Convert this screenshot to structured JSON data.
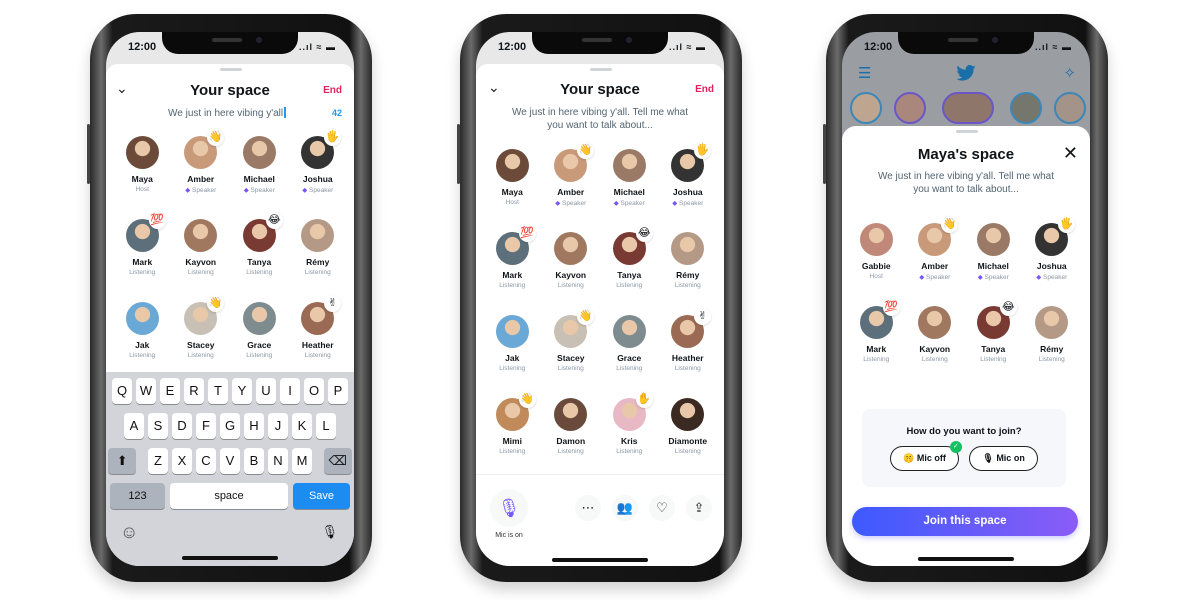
{
  "status": {
    "time": "12:00",
    "signal": "..ıl ≈ ▬"
  },
  "colors": {
    "accent_pink": "#e0245e",
    "twitter_blue": "#1d9bf0",
    "speaker_purple": "#7856ff",
    "join_gradient": [
      "#3d5afe",
      "#8b5cf6"
    ]
  },
  "phone1": {
    "title": "Your space",
    "end_label": "End",
    "title_input": "We just in here vibing y'all",
    "char_count": "42",
    "participants": [
      {
        "name": "Maya",
        "role": "Host",
        "emoji": "",
        "color": "#6b4a3a"
      },
      {
        "name": "Amber",
        "role": "Speaker",
        "emoji": "👋",
        "color": "#c89a7a"
      },
      {
        "name": "Michael",
        "role": "Speaker",
        "emoji": "",
        "color": "#9a7a66"
      },
      {
        "name": "Joshua",
        "role": "Speaker",
        "emoji": "🖐",
        "color": "#333"
      },
      {
        "name": "Mark",
        "role": "Listening",
        "emoji": "💯",
        "color": "#5c6f7a"
      },
      {
        "name": "Kayvon",
        "role": "Listening",
        "emoji": "",
        "color": "#a07860"
      },
      {
        "name": "Tanya",
        "role": "Listening",
        "emoji": "😂",
        "color": "#7a3a34"
      },
      {
        "name": "Rémy",
        "role": "Listening",
        "emoji": "",
        "color": "#b49a86"
      },
      {
        "name": "Jak",
        "role": "Listening",
        "emoji": "",
        "color": "#6aa8d6"
      },
      {
        "name": "Stacey",
        "role": "Listening",
        "emoji": "👋",
        "color": "#c8c0b4"
      },
      {
        "name": "Grace",
        "role": "Listening",
        "emoji": "",
        "color": "#7e8c90"
      },
      {
        "name": "Heather",
        "role": "Listening",
        "emoji": "✌",
        "color": "#9a6a54"
      }
    ],
    "keyboard": {
      "row1": [
        "Q",
        "W",
        "E",
        "R",
        "T",
        "Y",
        "U",
        "I",
        "O",
        "P"
      ],
      "row2": [
        "A",
        "S",
        "D",
        "F",
        "G",
        "H",
        "J",
        "K",
        "L"
      ],
      "row3": [
        "Z",
        "X",
        "C",
        "V",
        "B",
        "N",
        "M"
      ],
      "shift": "⬆",
      "backspace": "⌫",
      "numbers": "123",
      "space": "space",
      "save": "Save",
      "emoji": "☺",
      "mic": "🎙"
    }
  },
  "phone2": {
    "title": "Your space",
    "end_label": "End",
    "description": "We just in here vibing y'all. Tell me what you want to talk about...",
    "participants": [
      {
        "name": "Maya",
        "role": "Host",
        "emoji": "",
        "color": "#6b4a3a"
      },
      {
        "name": "Amber",
        "role": "Speaker",
        "emoji": "👋",
        "color": "#c89a7a"
      },
      {
        "name": "Michael",
        "role": "Speaker",
        "emoji": "",
        "color": "#9a7a66"
      },
      {
        "name": "Joshua",
        "role": "Speaker",
        "emoji": "🖐",
        "color": "#333"
      },
      {
        "name": "Mark",
        "role": "Listening",
        "emoji": "💯",
        "color": "#5c6f7a"
      },
      {
        "name": "Kayvon",
        "role": "Listening",
        "emoji": "",
        "color": "#a07860"
      },
      {
        "name": "Tanya",
        "role": "Listening",
        "emoji": "😂",
        "color": "#7a3a34"
      },
      {
        "name": "Rémy",
        "role": "Listening",
        "emoji": "",
        "color": "#b49a86"
      },
      {
        "name": "Jak",
        "role": "Listening",
        "emoji": "",
        "color": "#6aa8d6"
      },
      {
        "name": "Stacey",
        "role": "Listening",
        "emoji": "👋",
        "color": "#c8c0b4"
      },
      {
        "name": "Grace",
        "role": "Listening",
        "emoji": "",
        "color": "#7e8c90"
      },
      {
        "name": "Heather",
        "role": "Listening",
        "emoji": "✌",
        "color": "#9a6a54"
      },
      {
        "name": "Mimi",
        "role": "Listening",
        "emoji": "👋",
        "color": "#c08a5a"
      },
      {
        "name": "Damon",
        "role": "Listening",
        "emoji": "",
        "color": "#6a4a3a"
      },
      {
        "name": "Kris",
        "role": "Listening",
        "emoji": "✋",
        "color": "#e8b8c4"
      },
      {
        "name": "Diamonte",
        "role": "Listening",
        "emoji": "",
        "color": "#3a2a22"
      }
    ],
    "mic_label": "Mic is on",
    "controls": [
      {
        "icon": "more-icon",
        "glyph": "⋯"
      },
      {
        "icon": "people-icon",
        "glyph": "👥"
      },
      {
        "icon": "heart-add-icon",
        "glyph": "♡"
      },
      {
        "icon": "share-icon",
        "glyph": "⇪"
      }
    ]
  },
  "phone3": {
    "title": "Maya's space",
    "description": "We just in here vibing y'all. Tell me what you want to talk about...",
    "participants": [
      {
        "name": "Gabbie",
        "role": "Host",
        "emoji": "",
        "color": "#c08878"
      },
      {
        "name": "Amber",
        "role": "Speaker",
        "emoji": "👋",
        "color": "#c89a7a"
      },
      {
        "name": "Michael",
        "role": "Speaker",
        "emoji": "",
        "color": "#9a7a66"
      },
      {
        "name": "Joshua",
        "role": "Speaker",
        "emoji": "🖐",
        "color": "#333"
      },
      {
        "name": "Mark",
        "role": "Listening",
        "emoji": "💯",
        "color": "#5c6f7a"
      },
      {
        "name": "Kayvon",
        "role": "Listening",
        "emoji": "",
        "color": "#a07860"
      },
      {
        "name": "Tanya",
        "role": "Listening",
        "emoji": "😂",
        "color": "#7a3a34"
      },
      {
        "name": "Rémy",
        "role": "Listening",
        "emoji": "",
        "color": "#b49a86"
      }
    ],
    "join_question": "How do you want to join?",
    "mic_off": "Mic off",
    "mic_off_emoji": "🤫",
    "mic_on": "Mic on",
    "mic_on_emoji": "🎙",
    "selected": "Mic off",
    "join_button": "Join this space",
    "fleets": [
      "#c9a88a",
      "#b08070",
      "#8a6a58",
      "#6a6a5a",
      "#a89080"
    ]
  }
}
